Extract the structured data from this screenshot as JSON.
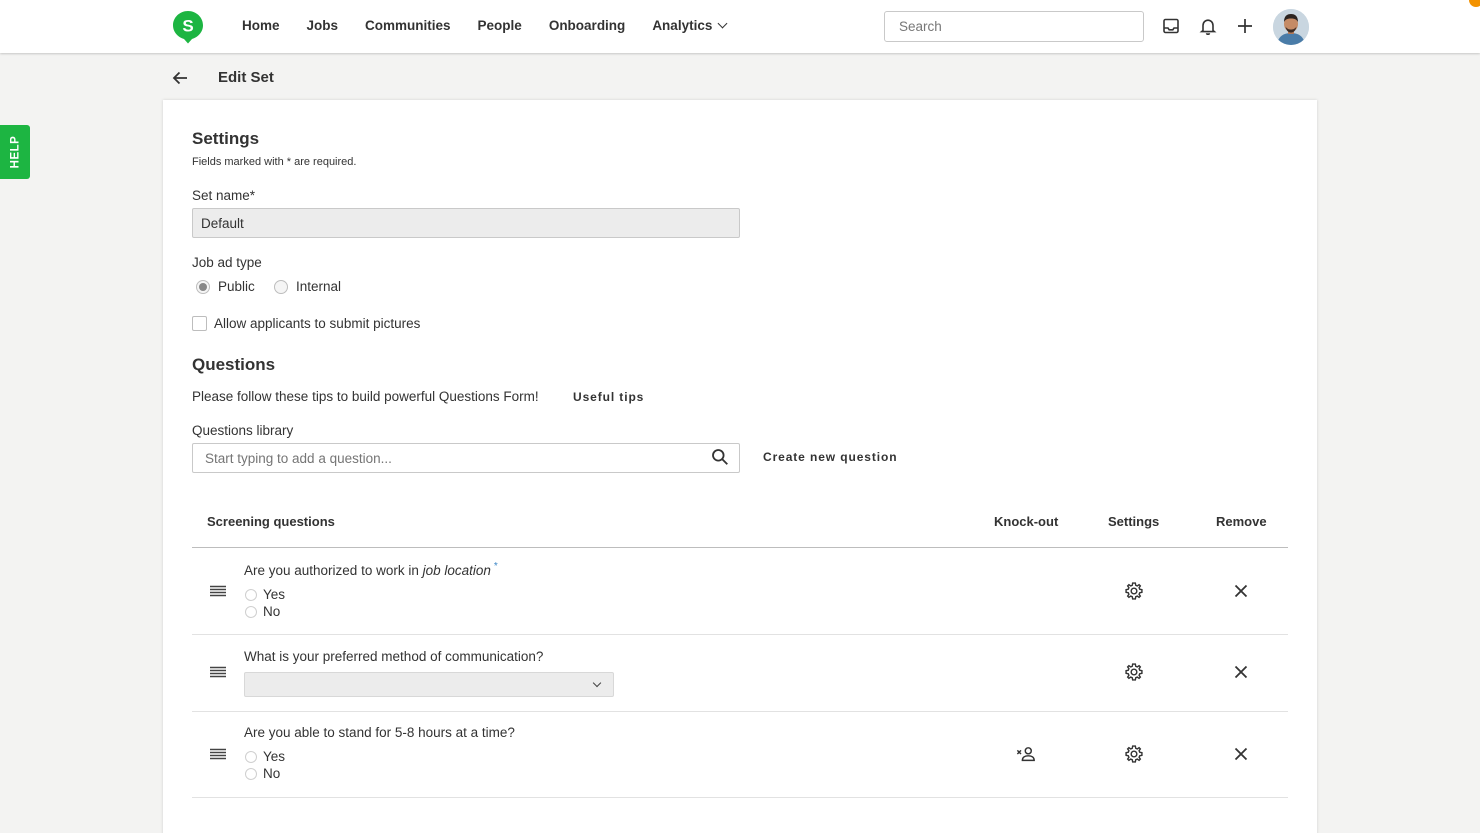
{
  "colors": {
    "brand_green": "#1db542",
    "accent_orange": "#f39200",
    "required_blue": "#3b86c6"
  },
  "logo": {
    "letter": "S"
  },
  "nav": {
    "items": [
      "Home",
      "Jobs",
      "Communities",
      "People",
      "Onboarding"
    ],
    "analytics_label": "Analytics",
    "search_placeholder": "Search",
    "icons": [
      "inbox-icon",
      "bell-icon",
      "plus-icon"
    ]
  },
  "help": {
    "label": "HELP"
  },
  "header": {
    "title": "Edit Set"
  },
  "settings": {
    "title": "Settings",
    "required_note": "Fields marked with * are required.",
    "set_name_label": "Set name*",
    "set_name_value": "Default",
    "job_ad_type_label": "Job ad type",
    "job_ad_options": [
      {
        "label": "Public",
        "selected": true
      },
      {
        "label": "Internal",
        "selected": false
      }
    ],
    "allow_pictures_label": "Allow applicants to submit pictures",
    "allow_pictures_checked": false
  },
  "questions": {
    "title": "Questions",
    "tips_text": "Please follow these tips to build powerful Questions Form!",
    "useful_tips_label": "Useful tips",
    "library_label": "Questions library",
    "library_placeholder": "Start typing to add a question...",
    "create_new_label": "Create new question",
    "table": {
      "headers": {
        "screening": "Screening questions",
        "knockout": "Knock-out",
        "settings": "Settings",
        "remove": "Remove"
      },
      "rows": [
        {
          "text_prefix": "Are you authorized to work in ",
          "text_italic": "job location",
          "required_mark": "*",
          "options": [
            "Yes",
            "No"
          ],
          "knockout": false
        },
        {
          "text": "What is your preferred method of communication?",
          "select_value": "",
          "knockout": false
        },
        {
          "text": "Are you able to stand for 5-8 hours at a time?",
          "options": [
            "Yes",
            "No"
          ],
          "knockout": true
        }
      ]
    }
  }
}
